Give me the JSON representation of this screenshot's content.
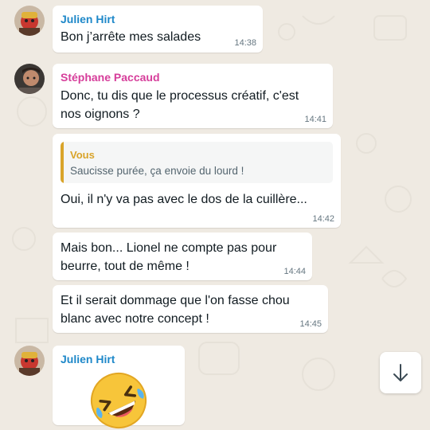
{
  "colors": {
    "julien": "#1e88c9",
    "stephane": "#d63d9a",
    "reply_you": "#d9a42a"
  },
  "messages": [
    {
      "sender": "Julien Hirt",
      "text": "Bon j’arrête mes salades",
      "time": "14:38"
    },
    {
      "sender": "Stéphane Paccaud",
      "line1": "Donc, tu dis que le processus créatif, c'est",
      "line2": "nos oignons ?",
      "time": "14:41"
    },
    {
      "quote_sender": "Vous",
      "quote_text": "Saucisse purée, ça envoie du lourd !",
      "text": "Oui, il n'y va pas avec le dos de la cuillère...",
      "time": "14:42"
    },
    {
      "line1": "Mais bon... Lionel ne compte pas pour",
      "line2": "beurre, tout de même !",
      "time": "14:44"
    },
    {
      "line1": "Et il serait dommage que l'on fasse chou",
      "line2": "blanc avec notre concept !",
      "time": "14:45"
    },
    {
      "sender": "Julien Hirt",
      "emoji": "rolling-on-the-floor-laughing"
    }
  ],
  "scroll_button": {
    "icon": "arrow-down-icon"
  }
}
